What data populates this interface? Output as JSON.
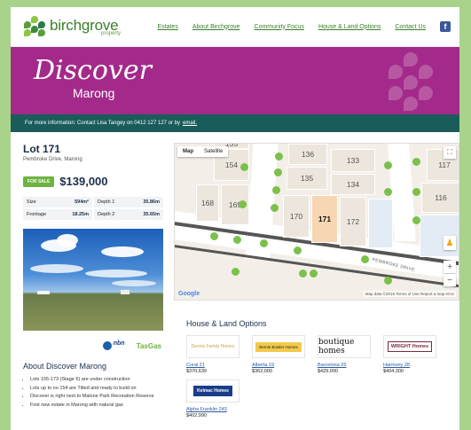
{
  "header": {
    "logo_text": "birchgrove",
    "logo_sub": "property",
    "nav": [
      "Estates",
      "About Birchgrove",
      "Community Focus",
      "House & Land Options",
      "Contact Us"
    ],
    "facebook_label": "f"
  },
  "hero": {
    "title": "Discover",
    "subtitle": "Marong"
  },
  "infobar": {
    "text": "For more information: Contact Lisa Tangey on 0412 127 127 or by",
    "link": "email."
  },
  "lot": {
    "title": "Lot 171",
    "address": "Pembroke Drive, Marong",
    "status": "FOR SALE",
    "price": "$139,000",
    "dims": [
      {
        "label": "Size",
        "value": "594m²"
      },
      {
        "label": "Depth 1",
        "value": "35.86m"
      },
      {
        "label": "Frontage",
        "value": "18.25m"
      },
      {
        "label": "Depth 2",
        "value": "35.65m"
      }
    ]
  },
  "partners": {
    "nbn": "nbn",
    "tagline": "TasGas"
  },
  "about": {
    "title": "About Discover Marong",
    "items": [
      "Lots 155-173 (Stage 6) are under construction",
      "Lots up to no 154 are Titled and ready to build on",
      "Discover is right next to Malone Park Recreation Reserve",
      "First new estate in Marong with natural gas"
    ]
  },
  "map": {
    "tabs": [
      "Map",
      "Satellite"
    ],
    "lots": [
      "135",
      "136",
      "133",
      "154",
      "134",
      "168",
      "169",
      "170",
      "171",
      "172",
      "117",
      "116",
      "155"
    ],
    "street": "PEMBROKE DRIVE",
    "google": "Google",
    "footer": "Map data ©2019   Terms of Use   Report a map error"
  },
  "house_land": {
    "title": "House & Land Options",
    "options": [
      {
        "builder": "Dennis Family Homes",
        "name": "Coral 21",
        "price": "$370,639"
      },
      {
        "builder": "Bernie Bowler Homes",
        "name": "Alberta 19",
        "price": "$363,000"
      },
      {
        "builder": "boutique homes",
        "name": "Barcelona 26",
        "price": "$429,000"
      },
      {
        "builder": "WRIGHT Homes",
        "name": "Harmony 28",
        "price": "$404,300"
      },
      {
        "builder": "Kelmac Homes",
        "name": "Alpha Franklin 243",
        "price": "$402,990"
      }
    ]
  },
  "colors": {
    "brand_green": "#3a7f2a",
    "hero_purple": "#a32a8a",
    "info_teal": "#1a5c5a",
    "accent_green": "#6cb33f",
    "selected_lot": "#f6d7b2"
  }
}
